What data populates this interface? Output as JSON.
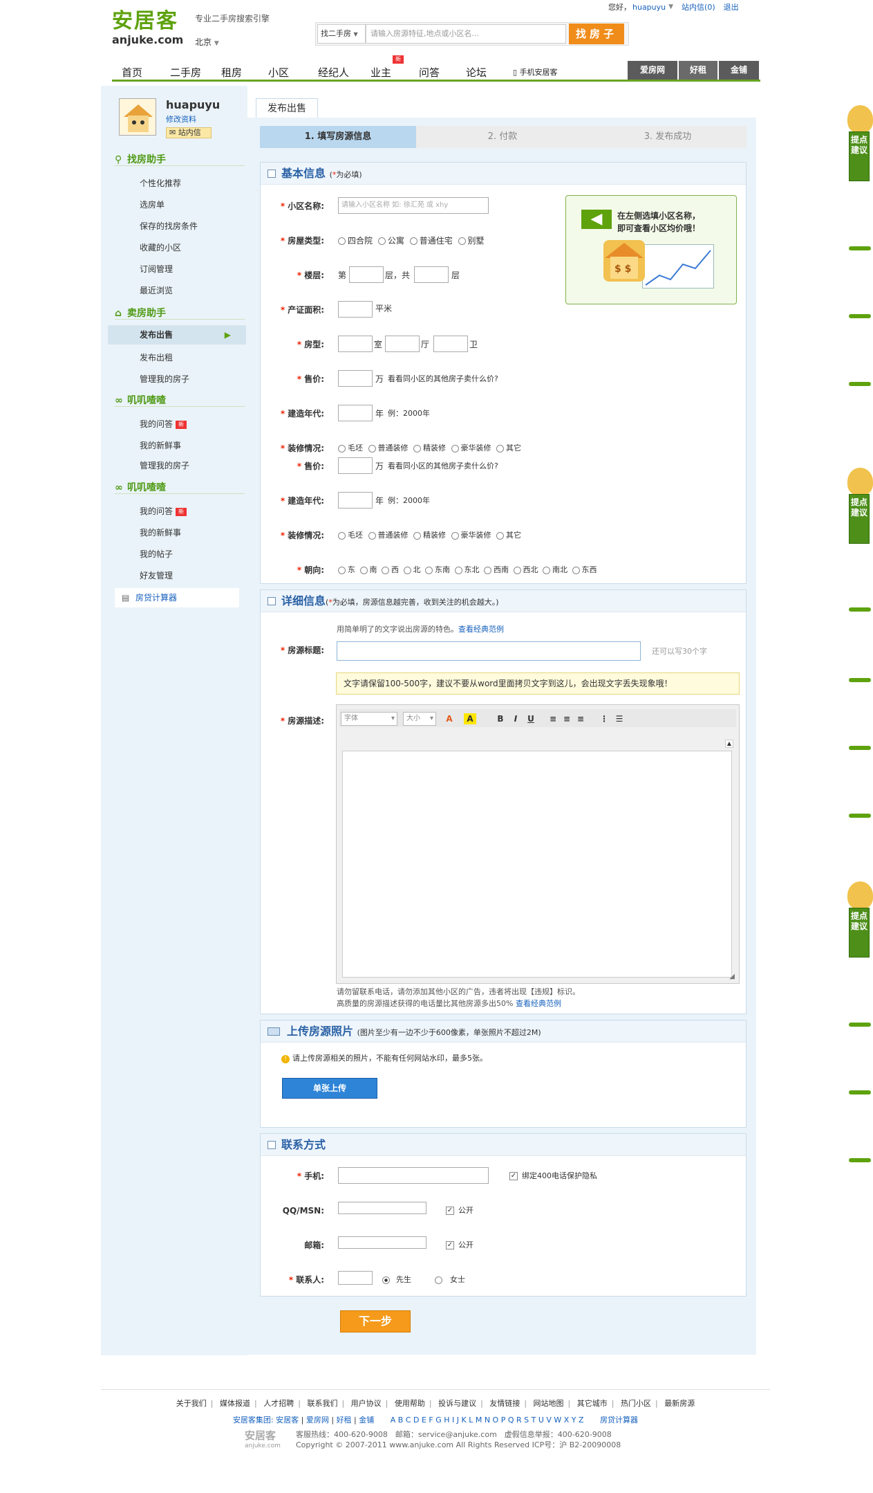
{
  "topbar": {
    "greeting": "您好，",
    "username": "huapuyu",
    "mail": "站内信(0)",
    "logout": "退出"
  },
  "logo": {
    "cn": "安居客",
    "en": "anjuke.com"
  },
  "slogan": "专业二手房搜索引擎",
  "city": "北京",
  "search": {
    "type": "找二手房",
    "placeholder": "请输入房源特征,地点或小区名...",
    "button": "找房子"
  },
  "nav": {
    "items": [
      "首页",
      "二手房",
      "租房",
      "小区",
      "经纪人",
      "业主",
      "问答",
      "论坛",
      "手机安居客"
    ],
    "new_badge": "新",
    "right": [
      "爱房网",
      "好租",
      "金铺"
    ]
  },
  "user": {
    "name": "huapuyu",
    "edit": "修改资料",
    "mail": "站内信"
  },
  "sidebar": {
    "sec1": "找房助手",
    "sec1_items": [
      "个性化推荐",
      "选房单",
      "保存的找房条件",
      "收藏的小区",
      "订阅管理",
      "最近浏览"
    ],
    "sec2": "卖房助手",
    "sec2_items": [
      "发布出售",
      "发布出租",
      "管理我的房子"
    ],
    "sec3": "叽叽喳喳",
    "sec3_items": [
      "我的问答",
      "我的新鲜事",
      "管理我的房子"
    ],
    "sec4": "叽叽喳喳",
    "sec4_items": [
      "我的问答",
      "我的新鲜事",
      "我的帖子",
      "好友管理"
    ],
    "calc": "房贷计算器",
    "new_badge": "新"
  },
  "tab": "发布出售",
  "steps": [
    "1. 填写房源信息",
    "2. 付款",
    "3. 发布成功"
  ],
  "basic": {
    "title": "基本信息",
    "sub_prefix": "(",
    "sub_star": "*",
    "sub_text": "为必填)",
    "community_label": "小区名称:",
    "community_placeholder": "请输入小区名称 如: 徐汇苑 或 xhy",
    "type_label": "房屋类型:",
    "types": [
      "四合院",
      "公寓",
      "普通住宅",
      "别墅"
    ],
    "floor_label": "楼层:",
    "floor_pre": "第",
    "floor_mid": "层，共",
    "floor_end": "层",
    "area_label": "产证面积:",
    "area_unit": "平米",
    "layout_label": "房型:",
    "layout_units": [
      "室",
      "厅",
      "卫"
    ],
    "price_label": "售价:",
    "price_unit": "万",
    "price_link": "看看同小区的其他房子卖什么价?",
    "year_label": "建造年代:",
    "year_unit": "年",
    "year_example": "例：2000年",
    "decor_label": "装修情况:",
    "decors": [
      "毛坯",
      "普通装修",
      "精装修",
      "豪华装修",
      "其它"
    ],
    "orient_label": "朝向:",
    "orients": [
      "东",
      "南",
      "西",
      "北",
      "东南",
      "东北",
      "西南",
      "西北",
      "南北",
      "东西"
    ],
    "hint": [
      "在左侧选填小区名称，",
      "即可查看小区均价哦！"
    ]
  },
  "detail": {
    "title": "详细信息",
    "sub_prefix": "(",
    "sub_star": "*",
    "sub_text": "为必填，房源信息越完善，收到关注的机会越大。)",
    "intro": "用简单明了的文字说出房源的特色。",
    "intro_link": "查看经典范例",
    "title_label": "房源标题:",
    "title_hint": "还可以写30个字",
    "desc_label": "房源描述:",
    "tip": "文字请保留100-500字，建议不要从word里面拷贝文字到这儿，会出现文字丢失现象哦！",
    "font_family": "字体",
    "font_size": "大小",
    "toolbar": [
      "A",
      "A",
      "B",
      "I",
      "U"
    ],
    "note1": "请勿留联系电话，请勿添加其他小区的广告，违者将出现【违规】标识。",
    "note2": "高质量的房源描述获得的电话量比其他房源多出50%",
    "note2_link": "查看经典范例"
  },
  "photos": {
    "title": "上传房源照片",
    "sub": "(图片至少有一边不少于600像素，单张照片不超过2M)",
    "tip": "请上传房源相关的照片，不能有任何网站水印，最多5张。",
    "button": "单张上传"
  },
  "contact": {
    "title": "联系方式",
    "mobile_label": "手机:",
    "bind": "绑定400电话保护隐私",
    "qq_label": "QQ/MSN:",
    "mail_label": "邮箱:",
    "public": "公开",
    "person_label": "联系人:",
    "mr": "先生",
    "ms": "女士",
    "check_mark": "✓"
  },
  "next": "下一步",
  "feedback": "提点建议",
  "footer": {
    "links": [
      "关于我们",
      "媒体报道",
      "人才招聘",
      "联系我们",
      "用户协议",
      "使用帮助",
      "投诉与建议",
      "友情链接",
      "网站地图",
      "其它城市",
      "热门小区",
      "最新房源"
    ],
    "group_label": "安居客集团:",
    "group": [
      "安居客",
      "爱房网",
      "好租",
      "金铺"
    ],
    "letters": "A B C D E F G H I J K L M N O P Q R S T U V W X Y Z",
    "calc": "房贷计算器",
    "logo": "安居客",
    "logo_en": "anjuke.com",
    "line1": "客服热线：400-620-9008　邮箱：service@anjuke.com　虚假信息举报：400-620-9008",
    "line2": "Copyright © 2007-2011 www.anjuke.com All Rights Reserved ICP号：沪 B2-20090008"
  },
  "colors": {
    "brand_green": "#5ea20e",
    "link_blue": "#1560bd",
    "accent_orange": "#f08c1a"
  }
}
